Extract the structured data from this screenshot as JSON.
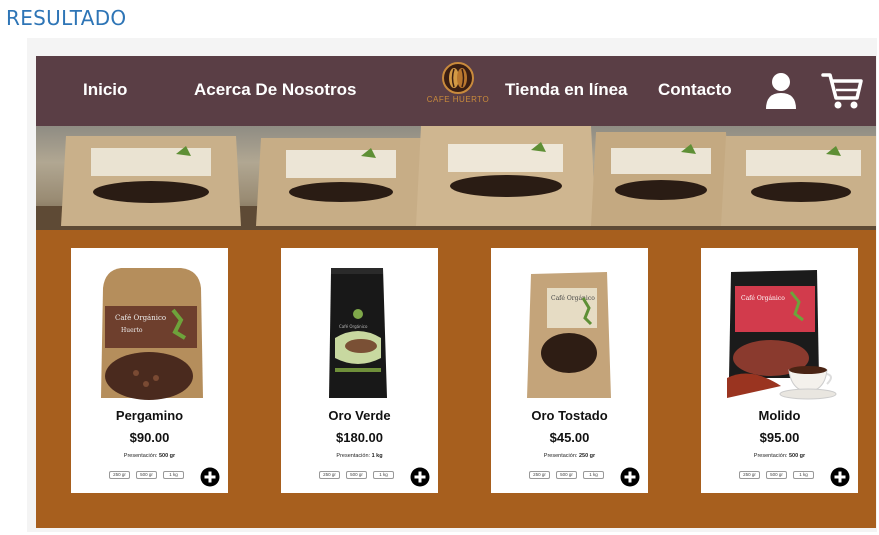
{
  "heading": "RESULTADO",
  "nav": {
    "links": [
      "Inicio",
      "Acerca De Nosotros",
      "Tienda en línea",
      "Contacto"
    ],
    "logo_text": "CAFE HUERTO",
    "user_icon": "user-icon",
    "cart_icon": "cart-icon"
  },
  "colors": {
    "navbar": "#5a3e45",
    "products_bg": "#a75f1e",
    "heading": "#2e75b6"
  },
  "products": [
    {
      "name": "Pergamino",
      "price": "$90.00",
      "presentation_label": "Presentación:",
      "presentation_value": "500 gr",
      "sizes": [
        "250 gr",
        "500 gr",
        "1 kg"
      ]
    },
    {
      "name": "Oro Verde",
      "price": "$180.00",
      "presentation_label": "Presentación:",
      "presentation_value": "1 kg",
      "sizes": [
        "250 gr",
        "500 gr",
        "1 kg"
      ]
    },
    {
      "name": "Oro Tostado",
      "price": "$45.00",
      "presentation_label": "Presentación:",
      "presentation_value": "250 gr",
      "sizes": [
        "250 gr",
        "500 gr",
        "1 kg"
      ]
    },
    {
      "name": "Molido",
      "price": "$95.00",
      "presentation_label": "Presentación:",
      "presentation_value": "500 gr",
      "sizes": [
        "250 gr",
        "500 gr",
        "1 kg"
      ]
    }
  ]
}
